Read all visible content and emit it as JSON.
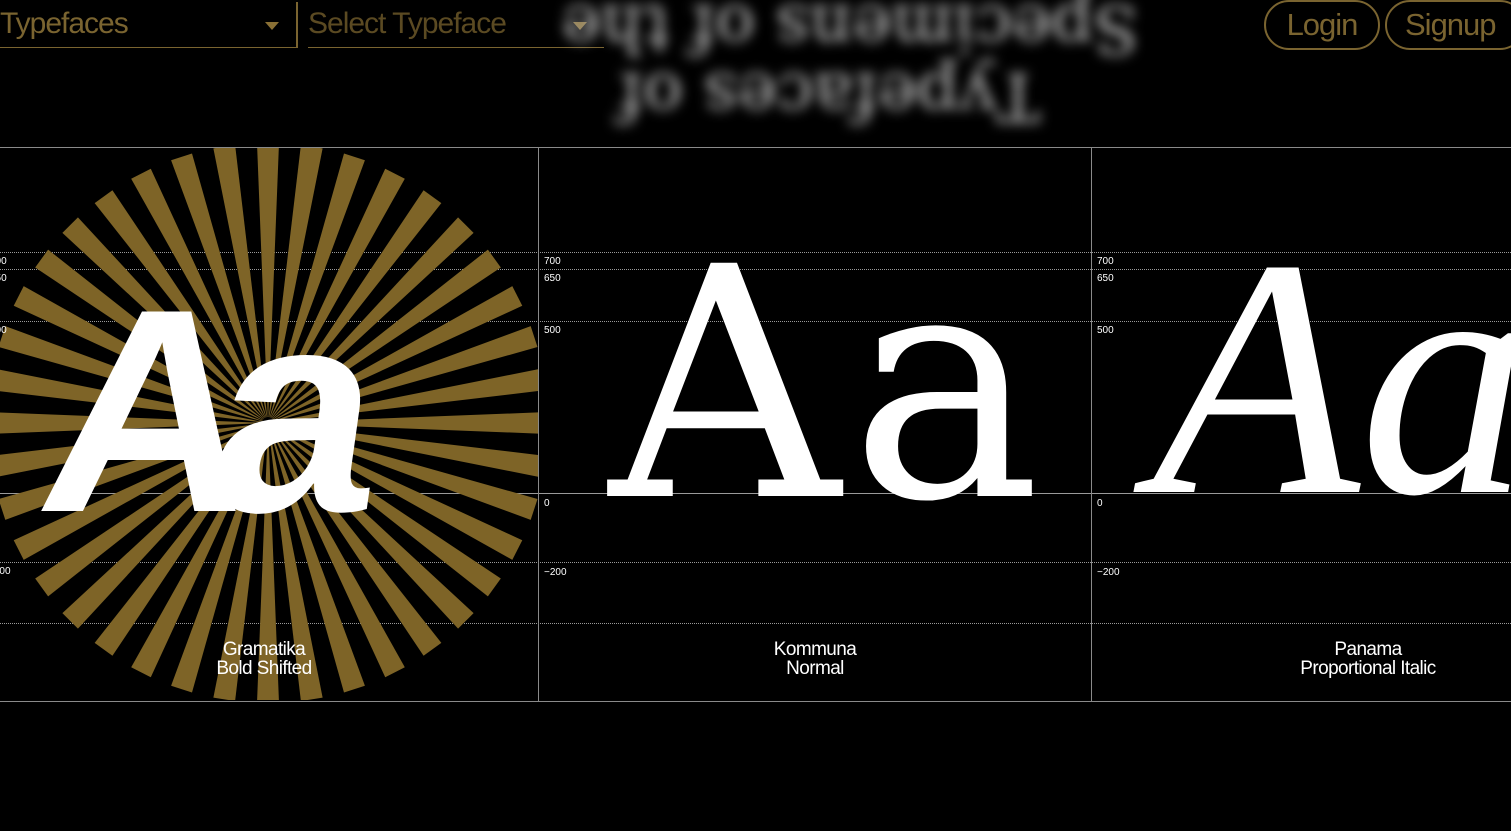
{
  "nav": {
    "typefaces_label": "Typefaces",
    "select_placeholder": "Select Typeface",
    "login_label": "Login",
    "signup_label": "Signup"
  },
  "background_heading": {
    "line1": "Specimens of the",
    "line2": "Typefaces of"
  },
  "metrics": {
    "ascender": "700",
    "cap_height": "650",
    "x_height": "500",
    "baseline": "0",
    "descender": "−200"
  },
  "specimens": [
    {
      "sample": "Aa",
      "family": "Gramatika",
      "style": "Bold Shifted"
    },
    {
      "sample": "Aa",
      "family": "Kommuna",
      "style": "Normal"
    },
    {
      "sample": "Aa",
      "family": "Panama",
      "style": "Proportional Italic"
    }
  ],
  "colors": {
    "accent": "#7a6430",
    "burst": "#7e6427",
    "background": "#000000",
    "text": "#ffffff",
    "guides": "#9a9a9a"
  }
}
